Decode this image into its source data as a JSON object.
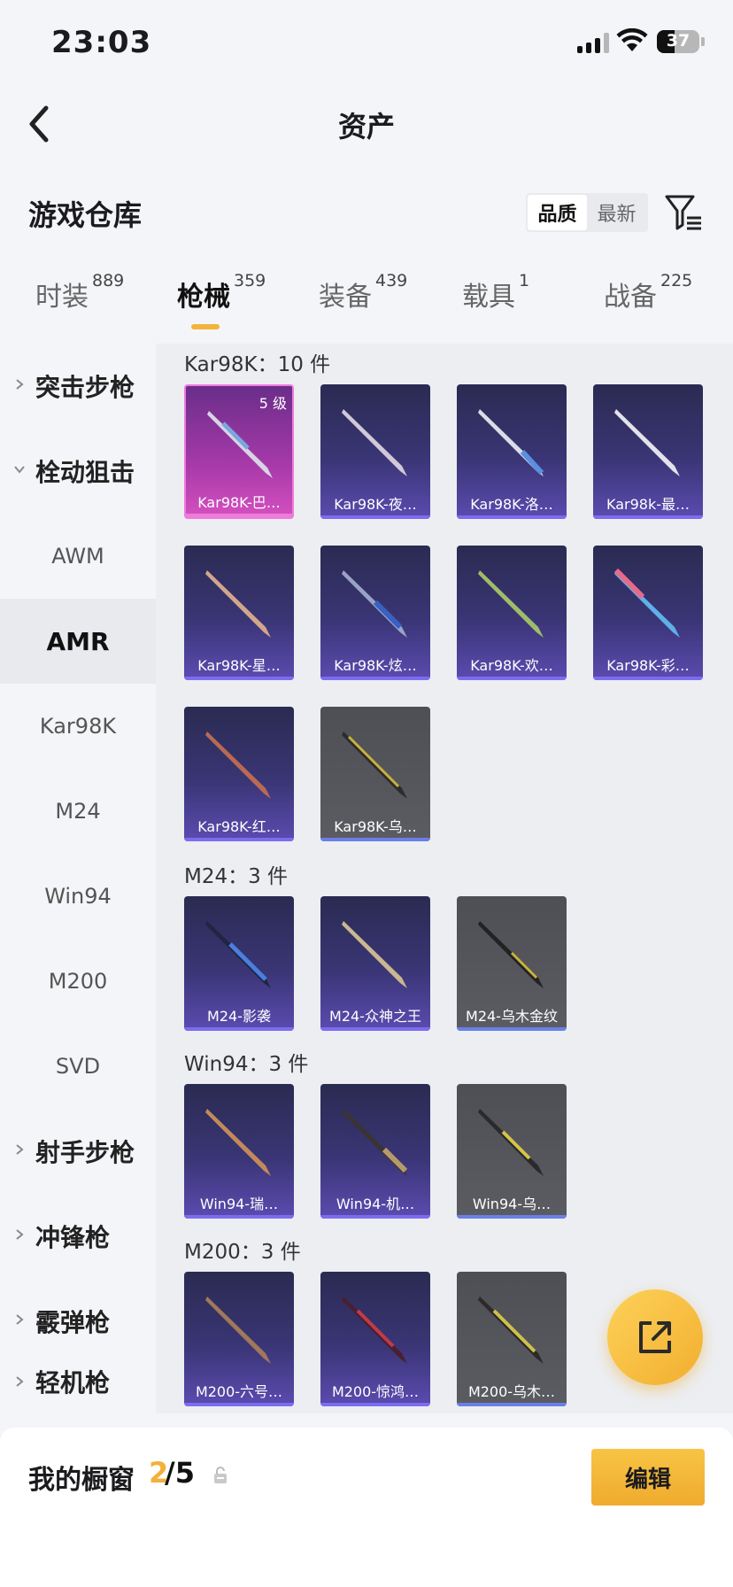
{
  "status_bar": {
    "time": "23:03",
    "battery": "37"
  },
  "nav": {
    "title": "资产"
  },
  "warehouse": {
    "title": "游戏仓库",
    "sort_options": [
      "品质",
      "最新"
    ]
  },
  "tabs": [
    {
      "label": "时装",
      "count": "889"
    },
    {
      "label": "枪械",
      "count": "359"
    },
    {
      "label": "装备",
      "count": "439"
    },
    {
      "label": "载具",
      "count": "1"
    },
    {
      "label": "战备",
      "count": "225"
    }
  ],
  "sidebar": [
    {
      "label": "突击步枪"
    },
    {
      "label": "栓动狙击"
    },
    {
      "label": "AWM"
    },
    {
      "label": "AMR"
    },
    {
      "label": "Kar98K"
    },
    {
      "label": "M24"
    },
    {
      "label": "Win94"
    },
    {
      "label": "M200"
    },
    {
      "label": "SVD"
    },
    {
      "label": "射手步枪"
    },
    {
      "label": "冲锋枪"
    },
    {
      "label": "霰弹枪"
    },
    {
      "label": "轻机枪"
    }
  ],
  "sections": [
    {
      "title": "Kar98K：10 件",
      "items": [
        {
          "label": "Kar98K-巴…",
          "level": "5 级"
        },
        {
          "label": "Kar98K-夜…"
        },
        {
          "label": "Kar98K-洛…"
        },
        {
          "label": "Kar98k-最…"
        },
        {
          "label": "Kar98K-星…"
        },
        {
          "label": "Kar98K-炫…"
        },
        {
          "label": "Kar98K-欢…"
        },
        {
          "label": "Kar98K-彩…"
        },
        {
          "label": "Kar98K-红…"
        },
        {
          "label": "Kar98K-乌…"
        }
      ]
    },
    {
      "title": "M24：3 件",
      "items": [
        {
          "label": "M24-影袭"
        },
        {
          "label": "M24-众神之王"
        },
        {
          "label": "M24-乌木金纹"
        }
      ]
    },
    {
      "title": "Win94：3 件",
      "items": [
        {
          "label": "Win94-瑞…"
        },
        {
          "label": "Win94-机…"
        },
        {
          "label": "Win94-乌…"
        }
      ]
    },
    {
      "title": "M200：3 件",
      "items": [
        {
          "label": "M200-六号…"
        },
        {
          "label": "M200-惊鸿…"
        },
        {
          "label": "M200-乌木…"
        }
      ]
    }
  ],
  "showcase": {
    "title": "我的橱窗",
    "count": "2",
    "total": "/5",
    "edit_label": "编辑"
  },
  "colors": {
    "accent": "#f2b13a",
    "purple_card": "#3a3575",
    "pink_card": "#a63aa8",
    "gray_card": "#55565c"
  }
}
